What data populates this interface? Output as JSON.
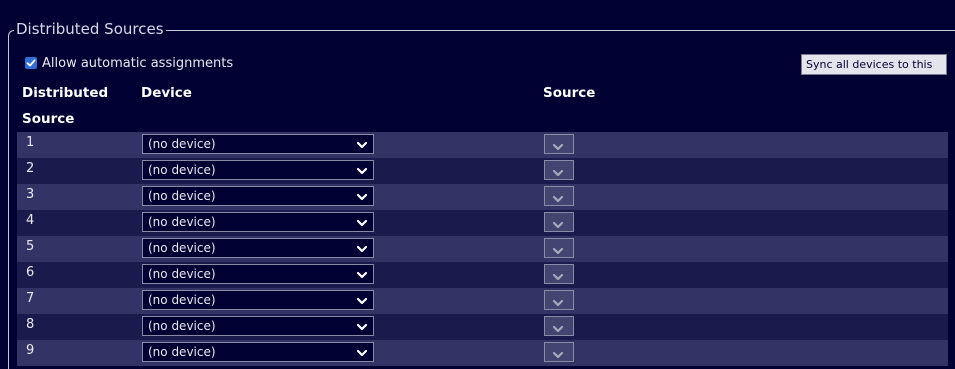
{
  "fieldset": {
    "legend": "Distributed Sources"
  },
  "auto_assign": {
    "label": "Allow automatic assignments",
    "checked": true
  },
  "sync_button": {
    "label": "Sync all devices to this"
  },
  "table": {
    "headers": {
      "distributed_source": "Distributed Source",
      "device": "Device",
      "source": "Source"
    },
    "rows": [
      {
        "number": "1",
        "device": "(no device)",
        "source": ""
      },
      {
        "number": "2",
        "device": "(no device)",
        "source": ""
      },
      {
        "number": "3",
        "device": "(no device)",
        "source": ""
      },
      {
        "number": "4",
        "device": "(no device)",
        "source": ""
      },
      {
        "number": "5",
        "device": "(no device)",
        "source": ""
      },
      {
        "number": "6",
        "device": "(no device)",
        "source": ""
      },
      {
        "number": "7",
        "device": "(no device)",
        "source": ""
      },
      {
        "number": "8",
        "device": "(no device)",
        "source": ""
      },
      {
        "number": "9",
        "device": "(no device)",
        "source": ""
      }
    ]
  },
  "colors": {
    "background": "#000033",
    "row_odd": "#333366",
    "row_even": "#1a1a4d",
    "checkbox_accent": "#2f6fd6"
  },
  "icons": {
    "checkbox": "checkmark-icon",
    "dropdown": "chevron-down-icon"
  }
}
